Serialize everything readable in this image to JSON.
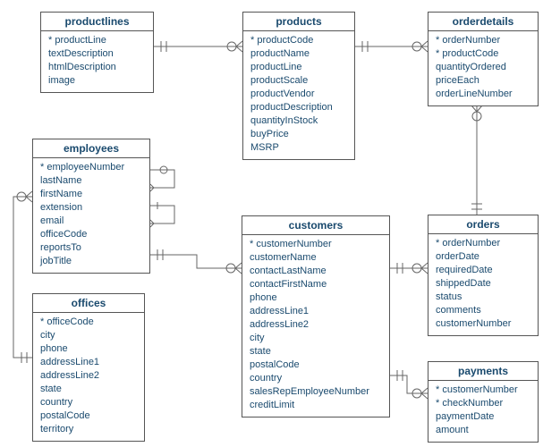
{
  "entities": {
    "productlines": {
      "title": "productlines",
      "fields": [
        {
          "name": "productLine",
          "key": true
        },
        {
          "name": "textDescription",
          "key": false
        },
        {
          "name": "htmlDescription",
          "key": false
        },
        {
          "name": "image",
          "key": false
        }
      ]
    },
    "products": {
      "title": "products",
      "fields": [
        {
          "name": "productCode",
          "key": true
        },
        {
          "name": "productName",
          "key": false
        },
        {
          "name": "productLine",
          "key": false
        },
        {
          "name": "productScale",
          "key": false
        },
        {
          "name": "productVendor",
          "key": false
        },
        {
          "name": "productDescription",
          "key": false
        },
        {
          "name": "quantityInStock",
          "key": false
        },
        {
          "name": "buyPrice",
          "key": false
        },
        {
          "name": "MSRP",
          "key": false
        }
      ]
    },
    "orderdetails": {
      "title": "orderdetails",
      "fields": [
        {
          "name": "orderNumber",
          "key": true
        },
        {
          "name": "productCode",
          "key": true
        },
        {
          "name": "quantityOrdered",
          "key": false
        },
        {
          "name": "priceEach",
          "key": false
        },
        {
          "name": "orderLineNumber",
          "key": false
        }
      ]
    },
    "employees": {
      "title": "employees",
      "fields": [
        {
          "name": "employeeNumber",
          "key": true
        },
        {
          "name": "lastName",
          "key": false
        },
        {
          "name": "firstName",
          "key": false
        },
        {
          "name": "extension",
          "key": false
        },
        {
          "name": "email",
          "key": false
        },
        {
          "name": "officeCode",
          "key": false
        },
        {
          "name": "reportsTo",
          "key": false
        },
        {
          "name": "jobTitle",
          "key": false
        }
      ]
    },
    "customers": {
      "title": "customers",
      "fields": [
        {
          "name": "customerNumber",
          "key": true
        },
        {
          "name": "customerName",
          "key": false
        },
        {
          "name": "contactLastName",
          "key": false
        },
        {
          "name": "contactFirstName",
          "key": false
        },
        {
          "name": "phone",
          "key": false
        },
        {
          "name": "addressLine1",
          "key": false
        },
        {
          "name": "addressLine2",
          "key": false
        },
        {
          "name": "city",
          "key": false
        },
        {
          "name": "state",
          "key": false
        },
        {
          "name": "postalCode",
          "key": false
        },
        {
          "name": "country",
          "key": false
        },
        {
          "name": "salesRepEmployeeNumber",
          "key": false
        },
        {
          "name": "creditLimit",
          "key": false
        }
      ]
    },
    "orders": {
      "title": "orders",
      "fields": [
        {
          "name": "orderNumber",
          "key": true
        },
        {
          "name": "orderDate",
          "key": false
        },
        {
          "name": "requiredDate",
          "key": false
        },
        {
          "name": "shippedDate",
          "key": false
        },
        {
          "name": "status",
          "key": false
        },
        {
          "name": "comments",
          "key": false
        },
        {
          "name": "customerNumber",
          "key": false
        }
      ]
    },
    "offices": {
      "title": "offices",
      "fields": [
        {
          "name": "officeCode",
          "key": true
        },
        {
          "name": "city",
          "key": false
        },
        {
          "name": "phone",
          "key": false
        },
        {
          "name": "addressLine1",
          "key": false
        },
        {
          "name": "addressLine2",
          "key": false
        },
        {
          "name": "state",
          "key": false
        },
        {
          "name": "country",
          "key": false
        },
        {
          "name": "postalCode",
          "key": false
        },
        {
          "name": "territory",
          "key": false
        }
      ]
    },
    "payments": {
      "title": "payments",
      "fields": [
        {
          "name": "customerNumber",
          "key": true
        },
        {
          "name": "checkNumber",
          "key": true
        },
        {
          "name": "paymentDate",
          "key": false
        },
        {
          "name": "amount",
          "key": false
        }
      ]
    }
  },
  "relationships": [
    {
      "from": "productlines",
      "to": "products",
      "type": "one-to-many"
    },
    {
      "from": "products",
      "to": "orderdetails",
      "type": "one-to-many"
    },
    {
      "from": "orders",
      "to": "orderdetails",
      "type": "one-to-many"
    },
    {
      "from": "customers",
      "to": "orders",
      "type": "one-to-many"
    },
    {
      "from": "customers",
      "to": "payments",
      "type": "one-to-many"
    },
    {
      "from": "employees",
      "to": "customers",
      "type": "one-to-many"
    },
    {
      "from": "employees",
      "to": "employees",
      "type": "one-to-many",
      "note": "self-reference reportsTo"
    },
    {
      "from": "offices",
      "to": "employees",
      "type": "one-to-many"
    }
  ]
}
